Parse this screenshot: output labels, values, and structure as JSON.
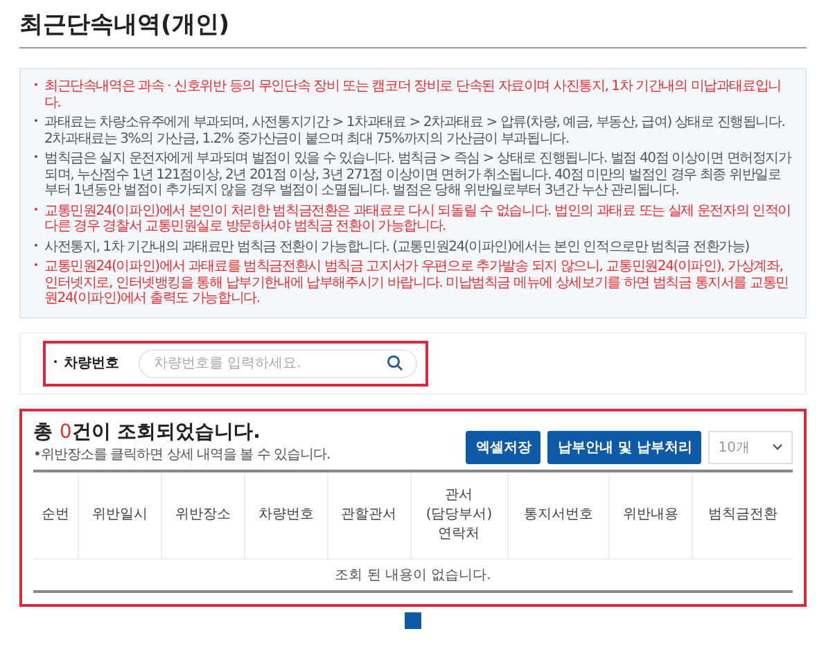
{
  "page_title": "최근단속내역(개인)",
  "notices": [
    {
      "text": "최근단속내역은 과속 · 신호위반 등의 무인단속 장비 또는 캠코더 장비로 단속된 자료이며 사진통지, 1차 기간내의 미납과태료입니다.",
      "highlighted": true
    },
    {
      "text": "과태료는 차량소유주에게 부과되며, 사전통지기간 > 1차과태료 > 2차과태료 > 압류(차량, 예금, 부동산, 급여) 상태로 진행됩니다. 2차과태료는 3%의 가산금, 1.2% 중가산금이 붙으며 최대 75%까지의 가산금이 부과됩니다.",
      "highlighted": false
    },
    {
      "text": "범칙금은 실지 운전자에게 부과되며 벌점이 있을 수 있습니다. 범칙금 > 즉심 > 상태로 진행됩니다. 벌점 40점 이상이면 면허정지가 되며, 누산점수 1년 121점이상, 2년 201점 이상, 3년 271점 이상이면 면허가 취소됩니다. 40점 미만의 벌점인 경우 최종 위반일로부터 1년동안 벌점이 추가되지 않을 경우 벌점이 소멸됩니다. 벌점은 당해 위반일로부터 3년간 누산 관리됩니다.",
      "highlighted": false
    },
    {
      "text": "교통민원24(이파인)에서 본인이 처리한 범칙금전환은 과태료로 다시 되돌릴 수 없습니다. 법인의 과태료 또는 실제 운전자의 인적이 다른 경우 경찰서 교통민원실로 방문하셔야 범칙금 전환이 가능합니다.",
      "highlighted": true
    },
    {
      "text": "사전통지, 1차 기간내의 과태료만 범칙금 전환이 가능합니다. (교통민원24(이파인)에서는 본인 인적으로만 범칙금 전환가능)",
      "highlighted": false
    },
    {
      "text": "교통민원24(이파인)에서 과태료를 범칙금전환시 범칙금 고지서가 우편으로 추가발송 되지 않으니, 교통민원24(이파인), 가상계좌, 인터넷지로, 인터넷뱅킹을 통해 납부기한내에 납부해주시기 바랍니다. 미납범칙금 메뉴에 상세보기를 하면 범칙금 통지서를 교통민원24(이파인)에서 출력도 가능합니다.",
      "highlighted": true
    }
  ],
  "search": {
    "label": "차량번호",
    "placeholder": "차량번호를 입력하세요."
  },
  "results": {
    "prefix": "총 ",
    "count": "0",
    "suffix": "건이 조회되었습니다.",
    "hint": "•위반장소를 클릭하면 상세 내역을 볼 수 있습니다.",
    "buttons": [
      "엑셀저장",
      "납부안내 및 납부처리"
    ],
    "page_size": "10개",
    "columns": [
      "순번",
      "위반일시",
      "위반장소",
      "차량번호",
      "관할관서",
      "관서\n(담당부서)\n연락처",
      "통지서번호",
      "위반내용",
      "범칙금전환"
    ],
    "empty_message": "조회 된 내용이 없습니다."
  }
}
